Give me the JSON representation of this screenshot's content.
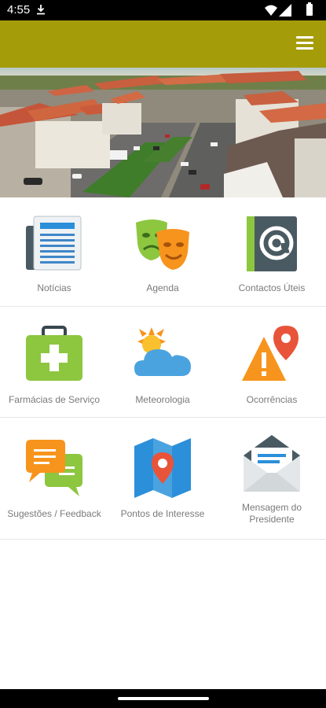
{
  "status_bar": {
    "time": "4:55",
    "icons": [
      "download-icon",
      "wifi-icon",
      "signal-icon",
      "battery-icon"
    ]
  },
  "app_bar": {
    "color": "#a59c0a",
    "menu_icon": "menu-icon"
  },
  "hero": {
    "description_icon": "town-photo"
  },
  "menu": [
    {
      "label": "Notícias",
      "icon": "newspaper-icon"
    },
    {
      "label": "Agenda",
      "icon": "theater-masks-icon"
    },
    {
      "label": "Contactos Úteis",
      "icon": "contacts-book-icon"
    },
    {
      "label": "Farmácias de Serviço",
      "icon": "first-aid-kit-icon"
    },
    {
      "label": "Meteorologia",
      "icon": "weather-icon"
    },
    {
      "label": "Ocorrências",
      "icon": "warning-location-icon"
    },
    {
      "label": "Sugestões / Feedback",
      "icon": "chat-bubbles-icon"
    },
    {
      "label": "Pontos de Interesse",
      "icon": "map-pin-icon"
    },
    {
      "label": "Mensagem do Presidente",
      "icon": "envelope-icon"
    }
  ],
  "colors": {
    "label": "#7a7a7a",
    "accent_green": "#8dc63f",
    "accent_orange": "#f7941d",
    "accent_blue": "#2b8fd9"
  }
}
